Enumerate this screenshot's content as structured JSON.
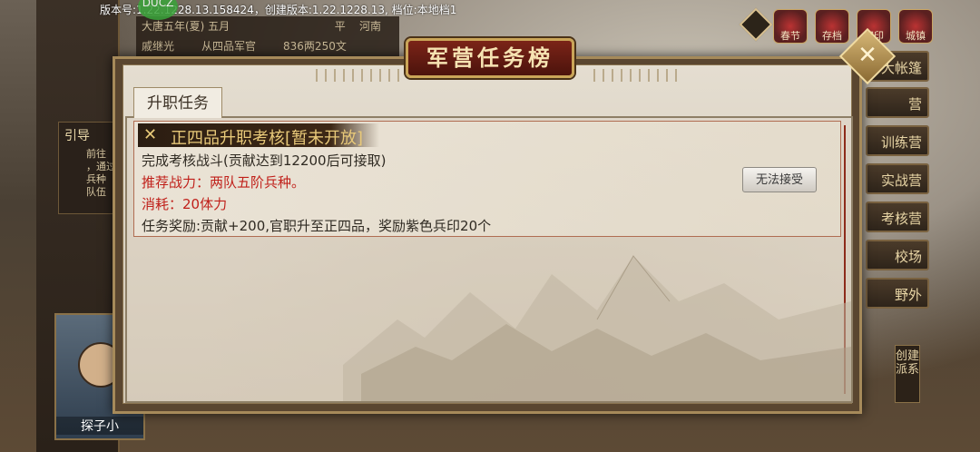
{
  "version_bar": "版本号:1.22.1228.13.158424，创建版本:1.22.1228.13, 档位:本地档1",
  "overlay_badge": "DUCZ",
  "top_info": {
    "row1": "大唐五年(夏) 五月",
    "row2_name": "戚继光",
    "row2_rank": "从四品军官",
    "row2_money": "836两250文",
    "row1_right_a": "平",
    "row1_right_b": "河南"
  },
  "top_icons": [
    "春节",
    "存档",
    "官印",
    "城镇"
  ],
  "right_menu": [
    "大帐篷",
    "营",
    "训练营",
    "实战营",
    "考核营",
    "校场",
    "野外"
  ],
  "left_guide": {
    "title": "引导",
    "lines": [
      "前往",
      "，通过",
      "兵种",
      "队伍"
    ]
  },
  "portrait_name": "探子小",
  "create_faction": "创建派系",
  "dialog": {
    "title": "军营任务榜",
    "tab_label": "升职任务",
    "close_glyph": "✕",
    "task": {
      "header_icon": "✕",
      "header_title": "正四品升职考核[暂未开放]",
      "line1": "完成考核战斗(贡献达到12200后可接取)",
      "line2": "推荐战力：两队五阶兵种。",
      "line3": "消耗：20体力",
      "line4": "任务奖励:贡献+200,官职升至正四品，奖励紫色兵印20个",
      "button_label": "无法接受"
    }
  },
  "colors": {
    "title_plate": "#7b2418",
    "header_text": "#e8c979",
    "accent_red": "#c0201a"
  }
}
